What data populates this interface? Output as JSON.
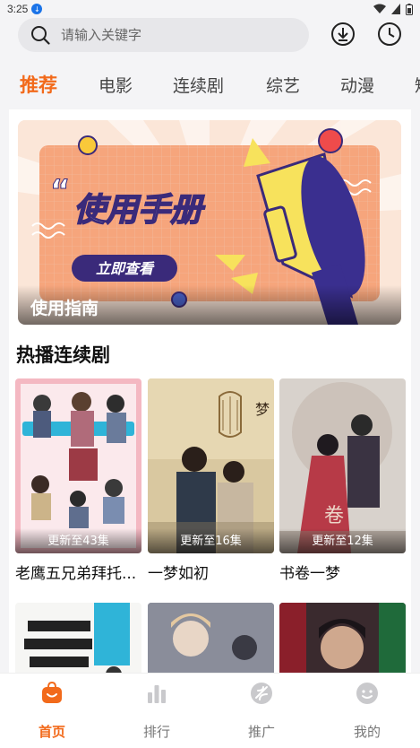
{
  "status_bar": {
    "time": "3:25"
  },
  "search": {
    "placeholder": "请输入关键字"
  },
  "tabs": [
    {
      "label": "推荐",
      "active": true
    },
    {
      "label": "电影"
    },
    {
      "label": "连续剧"
    },
    {
      "label": "综艺"
    },
    {
      "label": "动漫"
    },
    {
      "label": "短"
    }
  ],
  "banner": {
    "caption": "使用指南",
    "headline": "使用手册",
    "button": "立即查看"
  },
  "section": {
    "title": "热播连续剧"
  },
  "cards": [
    {
      "title": "老鹰五兄弟拜托...",
      "badge": "更新至43集"
    },
    {
      "title": "一梦如初",
      "badge": "更新至16集"
    },
    {
      "title": "书卷一梦",
      "badge": "更新至12集"
    }
  ],
  "bottom_nav": [
    {
      "label": "首页",
      "icon": "home-icon",
      "active": true
    },
    {
      "label": "排行",
      "icon": "ranking-icon"
    },
    {
      "label": "推广",
      "icon": "promote-icon"
    },
    {
      "label": "我的",
      "icon": "profile-icon"
    }
  ],
  "colors": {
    "accent": "#f26a1b"
  }
}
